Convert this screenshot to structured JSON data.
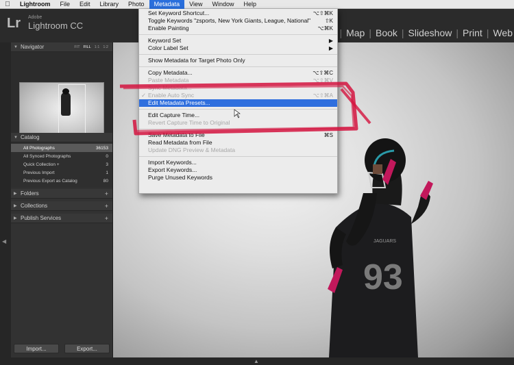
{
  "menubar": {
    "apple": "",
    "items": [
      "Lightroom",
      "File",
      "Edit",
      "Library",
      "Photo",
      "Metadata",
      "View",
      "Window",
      "Help"
    ]
  },
  "app": {
    "logo": "Lr",
    "brand": "Adobe",
    "product": "Lightroom CC"
  },
  "modules": [
    "Map",
    "Book",
    "Slideshow",
    "Print",
    "Web"
  ],
  "navigator": {
    "title": "Navigator",
    "options": [
      "FIT",
      "FILL",
      "1:1",
      "1:2"
    ]
  },
  "catalog": {
    "title": "Catalog",
    "rows": [
      {
        "label": "All Photographs",
        "count": "36153"
      },
      {
        "label": "All Synced Photographs",
        "count": "0"
      },
      {
        "label": "Quick Collection +",
        "count": "3"
      },
      {
        "label": "Previous Import",
        "count": "1"
      },
      {
        "label": "Previous Export as Catalog",
        "count": "80"
      }
    ]
  },
  "panels": {
    "folders": "Folders",
    "collections": "Collections",
    "publish": "Publish Services"
  },
  "buttons": {
    "import": "Import...",
    "export": "Export..."
  },
  "menu": {
    "items": [
      {
        "label": "Set Keyword Shortcut...",
        "shortcut": "⌥⇧⌘K",
        "state": "normal"
      },
      {
        "label": "Toggle Keywords \"zsports, New York Giants, League, National\"",
        "shortcut": "⇧K",
        "state": "normal"
      },
      {
        "label": "Enable Painting",
        "shortcut": "⌥⌘K",
        "state": "normal"
      },
      {
        "sep": true
      },
      {
        "label": "Keyword Set",
        "shortcut": "▶",
        "state": "normal"
      },
      {
        "label": "Color Label Set",
        "shortcut": "▶",
        "state": "normal"
      },
      {
        "sep": true
      },
      {
        "label": "Show Metadata for Target Photo Only",
        "shortcut": "",
        "state": "normal"
      },
      {
        "sep": true
      },
      {
        "label": "Copy Metadata...",
        "shortcut": "⌥⇧⌘C",
        "state": "normal"
      },
      {
        "label": "Paste Metadata",
        "shortcut": "⌥⇧⌘V",
        "state": "disabled"
      },
      {
        "label": "Sync Metadata...",
        "shortcut": "",
        "state": "disabled"
      },
      {
        "label": "Enable Auto Sync",
        "shortcut": "⌥⇧⌘A",
        "state": "disabled",
        "check": "✓"
      },
      {
        "label": "Edit Metadata Presets...",
        "shortcut": "",
        "state": "highlighted"
      },
      {
        "sep": true
      },
      {
        "label": "Edit Capture Time...",
        "shortcut": "",
        "state": "normal"
      },
      {
        "label": "Revert Capture Time to Original",
        "shortcut": "",
        "state": "disabled"
      },
      {
        "sep": true
      },
      {
        "label": "Save Metadata to File",
        "shortcut": "⌘S",
        "state": "normal"
      },
      {
        "label": "Read Metadata from File",
        "shortcut": "",
        "state": "normal"
      },
      {
        "label": "Update DNG Preview & Metadata",
        "shortcut": "",
        "state": "disabled"
      },
      {
        "sep": true
      },
      {
        "label": "Import Keywords...",
        "shortcut": "",
        "state": "normal"
      },
      {
        "label": "Export Keywords...",
        "shortcut": "",
        "state": "normal"
      },
      {
        "label": "Purge Unused Keywords",
        "shortcut": "",
        "state": "normal"
      }
    ]
  },
  "photo": {
    "jersey_number": "93",
    "jersey_text": "JAGUARS"
  },
  "colors": {
    "highlight": "#2f6fde",
    "annotation": "#d4143f"
  }
}
